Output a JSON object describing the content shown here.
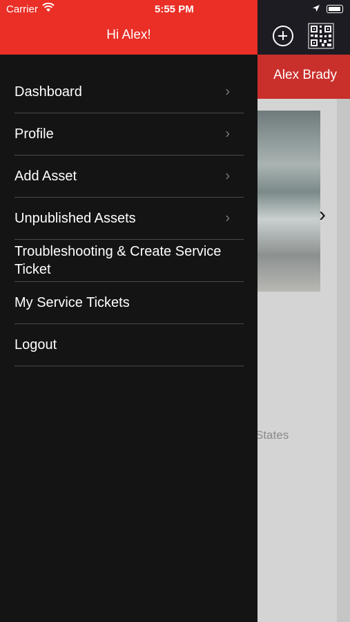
{
  "status_bar": {
    "carrier": "Carrier",
    "time": "5:55 PM"
  },
  "drawer": {
    "title": "Hi Alex!"
  },
  "menu": [
    {
      "label": "Dashboard",
      "has_chevron": true
    },
    {
      "label": "Profile",
      "has_chevron": true
    },
    {
      "label": "Add Asset",
      "has_chevron": true
    },
    {
      "label": "Unpublished Assets",
      "has_chevron": true
    },
    {
      "label": "Troubleshooting & Create Service Ticket",
      "has_chevron": false
    },
    {
      "label": "My Service Tickets",
      "has_chevron": false
    },
    {
      "label": "Logout",
      "has_chevron": false
    }
  ],
  "background": {
    "user_name": "Alex Brady",
    "partial_text": "States"
  },
  "colors": {
    "header_red": "#ea2f26",
    "drawer_bg": "#141414",
    "bar_red": "#c9302c"
  }
}
